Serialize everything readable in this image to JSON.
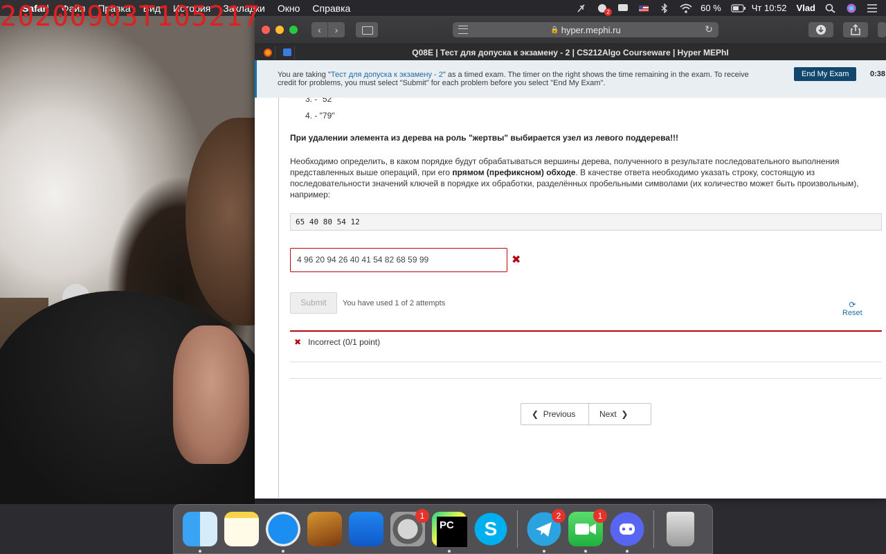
{
  "overlay": {
    "timestamp": "20200903T105217"
  },
  "menubar": {
    "apple": "",
    "app": "Safari",
    "menus": [
      "Файл",
      "Правка",
      "Вид",
      "История",
      "Закладки",
      "Окно",
      "Справка"
    ],
    "notif_badge": "2",
    "battery": "60 %",
    "clock": "Чт 10:52",
    "user": "Vlad"
  },
  "browser": {
    "url": "hyper.mephi.ru",
    "tab_title": "Q08E | Тест для допуска к экзамену - 2 | CS212Algo Courseware | Hyper MEPhI"
  },
  "exam_banner": {
    "text_before": "You are taking \"",
    "exam_link": "Тест для допуска к экзамену - 2",
    "text_after": "\" as a timed exam. The timer on the right shows the time remaining in the exam. To receive credit for problems, you must select \"Submit\" for each problem before you select \"End My Exam\".",
    "end_button": "End My Exam",
    "timer": "0:38:"
  },
  "problem": {
    "list_items": [
      "3.  - \"52\"",
      "4.  - \"79\""
    ],
    "warning": "При удалении элемента из дерева на роль \"жертвы\" выбирается узел из левого поддерева!!!",
    "desc_part1": "Необходимо определить, в каком порядке будут обрабатываться вершины дерева, полученного в результате последовательного выполнения представленных выше операций, при его ",
    "desc_bold": "прямом (префиксном) обходе",
    "desc_part2": ". В качестве ответа необходимо указать строку, состоящую из последовательности значений ключей в порядке их обработки, разделённых пробельными символами (их количество может быть произвольным), например:",
    "example": "65 40 80 54 12",
    "answer_value": "4 96 20 94 26 40 41 54 82 68 59 99",
    "submit_label": "Submit",
    "attempts_text": "You have used 1 of 2 attempts",
    "reset_label": "Reset",
    "result_text": "Incorrect (0/1 point)",
    "prev_label": "Previous",
    "next_label": "Next"
  },
  "dock": {
    "sysprefs_badge": "1",
    "telegram_badge": "2",
    "facetime_badge": "1"
  }
}
